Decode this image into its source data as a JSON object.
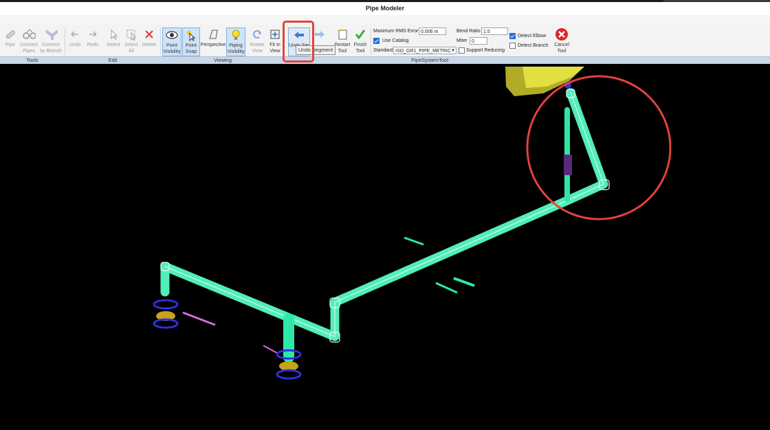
{
  "window": {
    "title": "Pipe Modeler"
  },
  "ribbon": {
    "groups": {
      "tools": "Tools",
      "edit": "Edit",
      "viewing": "Viewing",
      "pipesystem": "PipeSystemTool"
    },
    "buttons": {
      "pipe": "Pipe",
      "connect_pipes": "Connect Pipes",
      "connect_branch": "Connect by Branch",
      "undo": "Undo",
      "redo": "Redo",
      "select": "Select",
      "select_all": "Select All",
      "delete": "Delete",
      "point_visibility": "Point Visibility",
      "point_snap": "Point Snap",
      "perspective": "Perspective",
      "piping_visibility": "Piping Visibility",
      "rotate_view": "Rotate View",
      "fit_in_view": "Fit In View",
      "undo_segment": "Undo Segment",
      "redo_segment": "",
      "restart_tool": "Restart Tool",
      "finish_tool": "Finish Tool",
      "cancel_tool": "Cancel Tool"
    },
    "params": {
      "max_rms_label": "Maximum RMS Error",
      "max_rms_value": "0.006 m",
      "use_catalog_label": "Use Catalog",
      "use_catalog_checked": true,
      "standard_label": "Standard",
      "standard_value": "ISO_GR1_PIPE_METRIC",
      "bend_ratio_label": "Bend Ratio",
      "bend_ratio_value": "1.5",
      "miter_label": "Miter",
      "miter_value": "0",
      "support_reducing_label": "Support Reducing",
      "support_reducing_checked": false,
      "detect_elbow_label": "Detect Elbow",
      "detect_elbow_checked": true,
      "detect_branch_label": "Detect Branch",
      "detect_branch_checked": false
    }
  },
  "tooltip": {
    "text": "Undo Segment"
  },
  "colors": {
    "pipe": "#2ee8a6",
    "pipe_outline": "#bfffee",
    "flange": "#2f2fe0",
    "valve": "#c7a21a",
    "pointcloud": "#f2f24a",
    "magenta": "#d86bd8",
    "annotation": "#e3423a"
  }
}
